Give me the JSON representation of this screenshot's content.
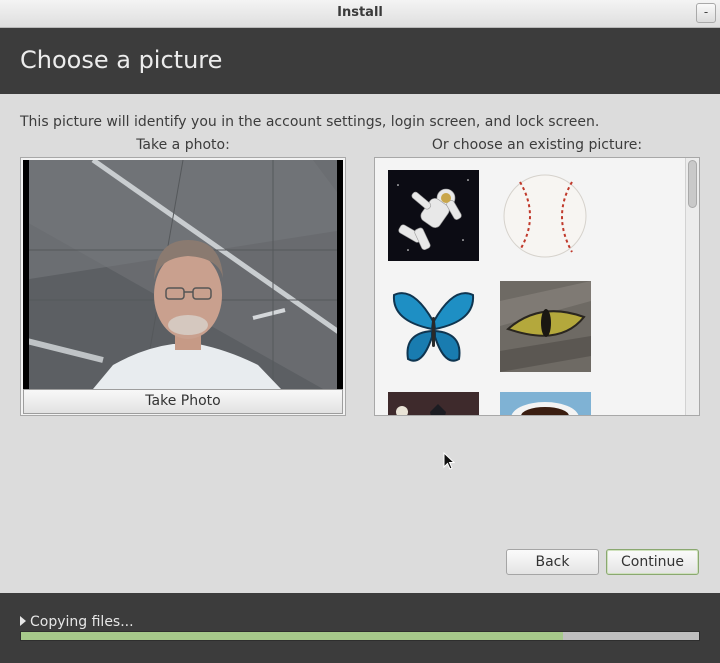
{
  "window": {
    "title": "Install",
    "minimize_glyph": "-"
  },
  "header": {
    "title": "Choose a picture"
  },
  "description": "This picture will identify you in the account settings, login screen, and lock screen.",
  "photo_panel": {
    "label": "Take a photo:",
    "button_label": "Take Photo"
  },
  "gallery": {
    "label": "Or choose an existing picture:",
    "items": [
      "astronaut-icon",
      "baseball-icon",
      "butterfly-icon",
      "cat-eye-icon",
      "chess-icon",
      "coffee-cup-icon"
    ]
  },
  "buttons": {
    "back": "Back",
    "continue": "Continue"
  },
  "footer": {
    "status": "Copying files...",
    "progress": 0.8
  },
  "colors": {
    "header_bg": "#3c3c3c",
    "progress_fill": "#a6c98a",
    "accent_border": "#8aa870"
  }
}
